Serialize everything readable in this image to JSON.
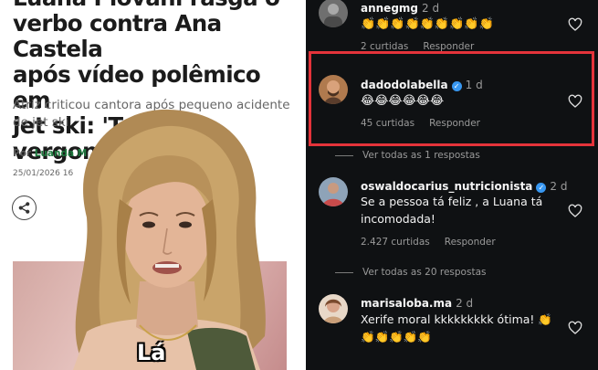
{
  "article": {
    "headline_line0": "Luana Piovani rasga o",
    "headline_line1": "verbo contra Ana Castela",
    "headline_line2": "após vídeo polêmico em",
    "headline_line3": "jet ski: 'Toma vergonha'",
    "subtitle": "Atriz criticou cantora após pequeno acidente de jet ski",
    "byline_prefix": "Por",
    "byline_author": "Luanda M",
    "date": "25/01/2026 16",
    "caption": "Lá",
    "share_icon": "share-icon"
  },
  "comments": [
    {
      "username": "annegmg",
      "verified": false,
      "time": "2 d",
      "text": "👏👏👏👏👏👏👏👏👏",
      "likes": "2 curtidas",
      "reply": "Responder"
    },
    {
      "username": "dadodolabella",
      "verified": true,
      "time": "1 d",
      "text": "😂😂😂😂😂😂",
      "likes": "45 curtidas",
      "reply": "Responder",
      "view_replies": "Ver todas as 1 respostas",
      "highlighted": true,
      "highlight_color": "#e4333a"
    },
    {
      "username": "oswaldocarius_nutricionista",
      "verified": true,
      "time": "2 d",
      "text": "Se a pessoa tá feliz , a Luana tá incomodada!",
      "likes": "2.427 curtidas",
      "reply": "Responder",
      "view_replies": "Ver todas as 20 respostas"
    },
    {
      "username": "marisaloba.ma",
      "verified": false,
      "time": "2 d",
      "text": "Xerife moral kkkkkkkkk ótima! 👏 👏👏👏👏👏"
    }
  ],
  "theme": {
    "comments_bg": "#0f1113",
    "verified_color": "#3897f0",
    "author_color": "#1d7a3e"
  }
}
